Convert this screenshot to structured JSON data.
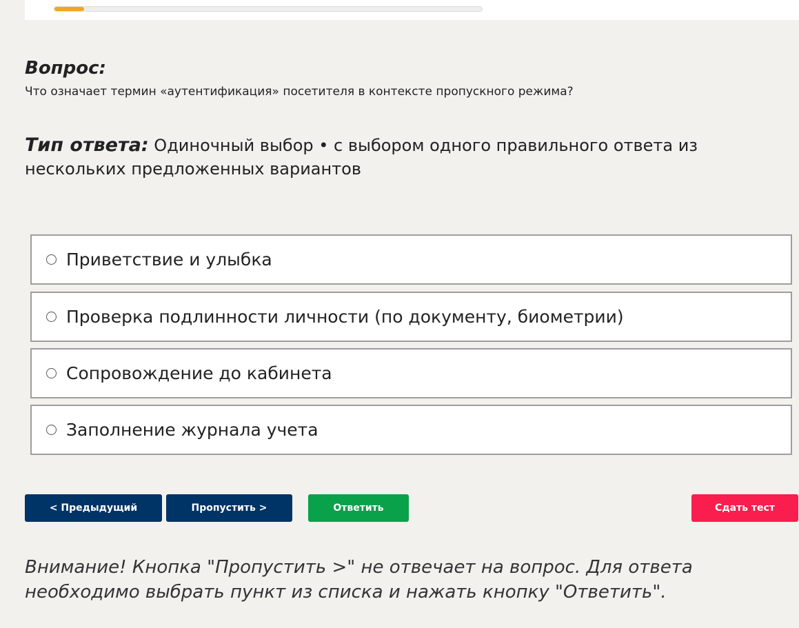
{
  "progress": {
    "fraction": 0.07
  },
  "question": {
    "heading": "Вопрос:",
    "text": "Что означает термин «аутентификация» посетителя в контексте пропускного режима?"
  },
  "answer_type": {
    "label": "Тип ответа:",
    "value": "Одиночный выбор • с выбором одного правильного ответа из нескольких предложенных вариантов"
  },
  "options": [
    {
      "label": "Приветствие и улыбка"
    },
    {
      "label": "Проверка подлинности личности (по документу, биометрии)"
    },
    {
      "label": "Сопровождение до кабинета"
    },
    {
      "label": "Заполнение журнала учета"
    }
  ],
  "buttons": {
    "previous": "< Предыдущий",
    "skip": "Пропустить >",
    "answer": "Ответить",
    "submit": "Сдать тест"
  },
  "notice": "Внимание! Кнопка \"Пропустить >\" не отвечает на вопрос. Для ответа необходимо выбрать пункт из списка и нажать кнопку \"Ответить\".",
  "colors": {
    "background": "#f2f1ee",
    "progress": "#f0a91e",
    "nav_button": "#003366",
    "answer_button": "#0aa14b",
    "submit_button": "#fa1e4e"
  }
}
